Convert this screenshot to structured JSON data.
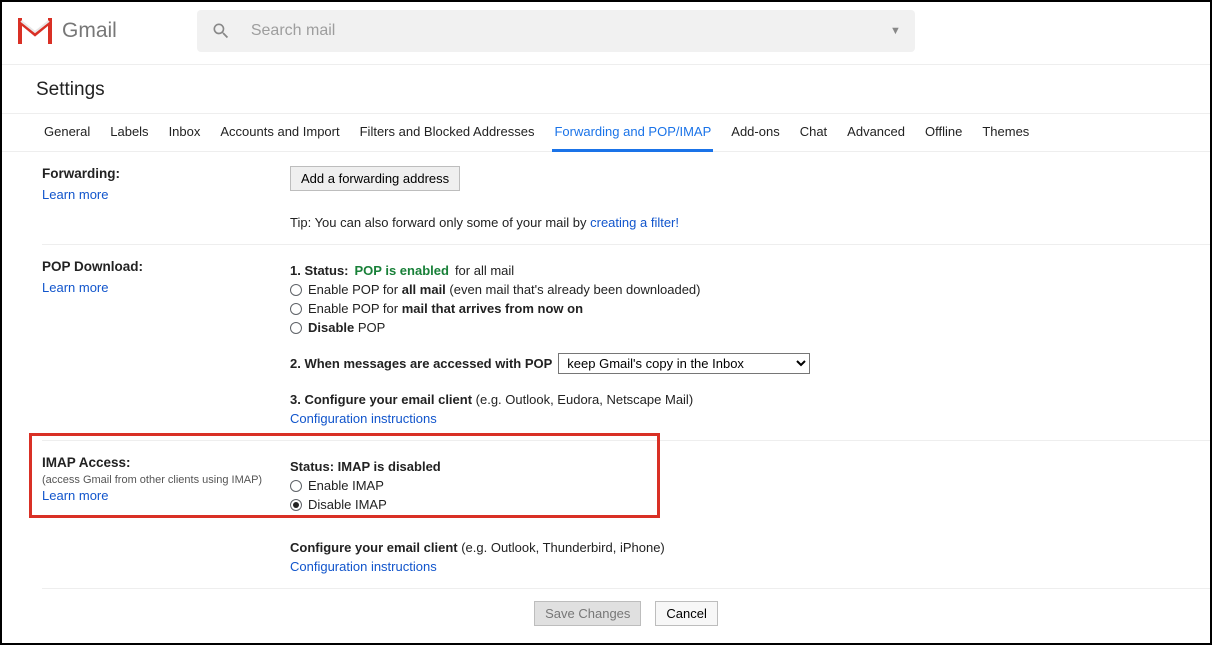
{
  "header": {
    "appName": "Gmail",
    "searchPlaceholder": "Search mail"
  },
  "pageTitle": "Settings",
  "tabs": [
    {
      "label": "General",
      "active": false
    },
    {
      "label": "Labels",
      "active": false
    },
    {
      "label": "Inbox",
      "active": false
    },
    {
      "label": "Accounts and Import",
      "active": false
    },
    {
      "label": "Filters and Blocked Addresses",
      "active": false
    },
    {
      "label": "Forwarding and POP/IMAP",
      "active": true
    },
    {
      "label": "Add-ons",
      "active": false
    },
    {
      "label": "Chat",
      "active": false
    },
    {
      "label": "Advanced",
      "active": false
    },
    {
      "label": "Offline",
      "active": false
    },
    {
      "label": "Themes",
      "active": false
    }
  ],
  "forwarding": {
    "title": "Forwarding:",
    "learn": "Learn more",
    "addBtn": "Add a forwarding address",
    "tipPrefix": "Tip: You can also forward only some of your mail by ",
    "tipLink": "creating a filter!"
  },
  "pop": {
    "title": "POP Download:",
    "learn": "Learn more",
    "s1_prefix": "1. Status: ",
    "s1_status": "POP is enabled",
    "s1_suffix": " for all mail",
    "r1_a": "Enable POP for ",
    "r1_b": "all mail",
    "r1_c": " (even mail that's already been downloaded)",
    "r2_a": "Enable POP for ",
    "r2_b": "mail that arrives from now on",
    "r3_a": "Disable",
    "r3_b": " POP",
    "s2": "2. When messages are accessed with POP",
    "selectValue": "keep Gmail's copy in the Inbox",
    "s3_a": "3. Configure your email client",
    "s3_b": " (e.g. Outlook, Eudora, Netscape Mail)",
    "configLink": "Configuration instructions"
  },
  "imap": {
    "title": "IMAP Access:",
    "sub": "(access Gmail from other clients using IMAP)",
    "learn": "Learn more",
    "status": "Status: IMAP is disabled",
    "enable": "Enable IMAP",
    "disable": "Disable IMAP",
    "cfg_a": "Configure your email client",
    "cfg_b": " (e.g. Outlook, Thunderbird, iPhone)",
    "configLink": "Configuration instructions"
  },
  "footer": {
    "save": "Save Changes",
    "cancel": "Cancel"
  }
}
